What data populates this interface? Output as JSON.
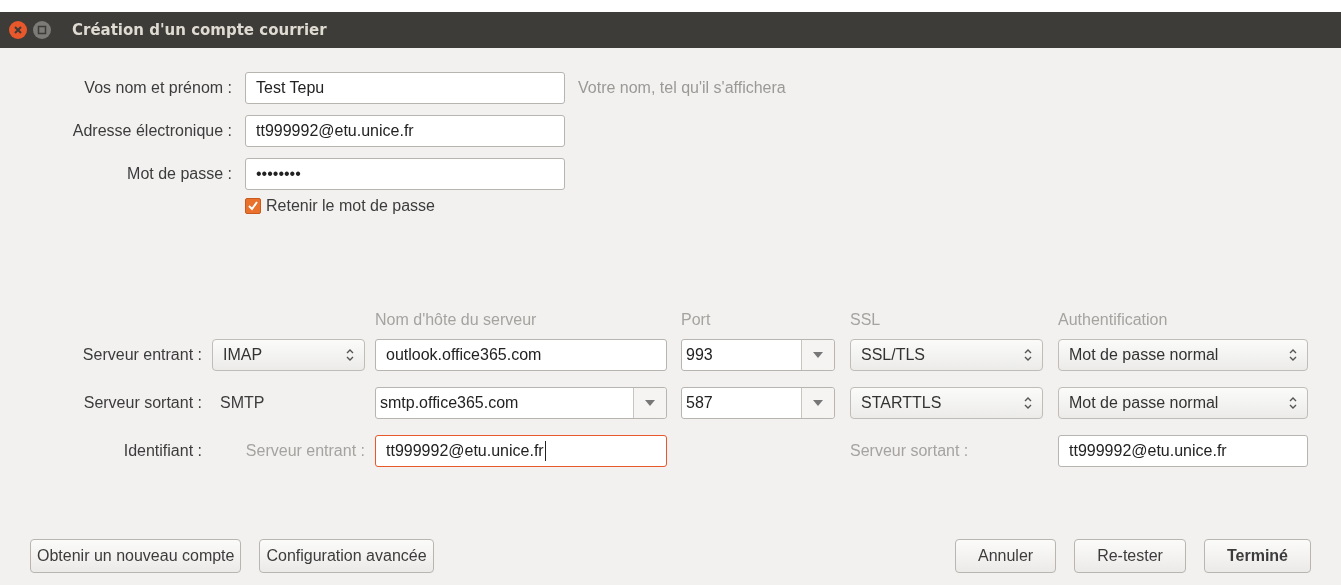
{
  "window": {
    "title": "Création d'un compte courrier"
  },
  "identity": [
    {
      "label": "Vos nom et prénom :",
      "value": "Test Tepu",
      "hint": "Votre nom, tel qu'il s'affichera"
    },
    {
      "label": "Adresse électronique :",
      "value": "tt999992@etu.unice.fr"
    },
    {
      "label": "Mot de passe :",
      "value": "••••••••"
    }
  ],
  "remember_password": {
    "label": "Retenir le mot de passe",
    "checked": true
  },
  "server_columns": [
    "Nom d'hôte du serveur",
    "Port",
    "SSL",
    "Authentification"
  ],
  "servers": [
    {
      "label": "Serveur entrant :",
      "protocol": {
        "kind": "select",
        "value": "IMAP"
      },
      "hostname": {
        "kind": "entry",
        "value": "outlook.office365.com"
      },
      "port": "993",
      "ssl": "SSL/TLS",
      "auth": "Mot de passe normal"
    },
    {
      "label": "Serveur sortant :",
      "protocol": {
        "kind": "text",
        "value": "SMTP"
      },
      "hostname": {
        "kind": "combo",
        "value": "smtp.office365.com"
      },
      "port": "587",
      "ssl": "STARTTLS",
      "auth": "Mot de passe normal"
    }
  ],
  "identifier": {
    "label": "Identifiant :",
    "incoming_label": "Serveur entrant :",
    "incoming_value": "tt999992@etu.unice.fr",
    "incoming_focused": true,
    "outgoing_label": "Serveur sortant :",
    "outgoing_value": "tt999992@etu.unice.fr"
  },
  "left_buttons": [
    {
      "label": "Obtenir un nouveau compte",
      "default": false
    },
    {
      "label": "Configuration avancée",
      "default": false
    }
  ],
  "right_buttons": [
    {
      "label": "Annuler",
      "default": false
    },
    {
      "label": "Re-tester",
      "default": false
    },
    {
      "label": "Terminé",
      "default": true
    }
  ]
}
